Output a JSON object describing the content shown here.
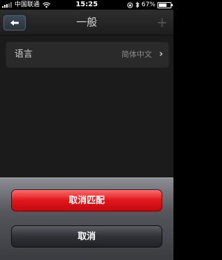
{
  "status_bar": {
    "carrier": "中国联通",
    "time": "15:25",
    "battery_percent": "67%",
    "battery_level": 0.67
  },
  "nav": {
    "title": "一般",
    "back_icon": "back-arrow-icon",
    "add_icon": "plus-icon"
  },
  "settings": {
    "rows": [
      {
        "label": "语言",
        "value": "简体中文"
      }
    ]
  },
  "action_sheet": {
    "destructive_label": "取消匹配",
    "cancel_label": "取消"
  },
  "colors": {
    "destructive": "#e0161b",
    "cancel": "#303136"
  }
}
